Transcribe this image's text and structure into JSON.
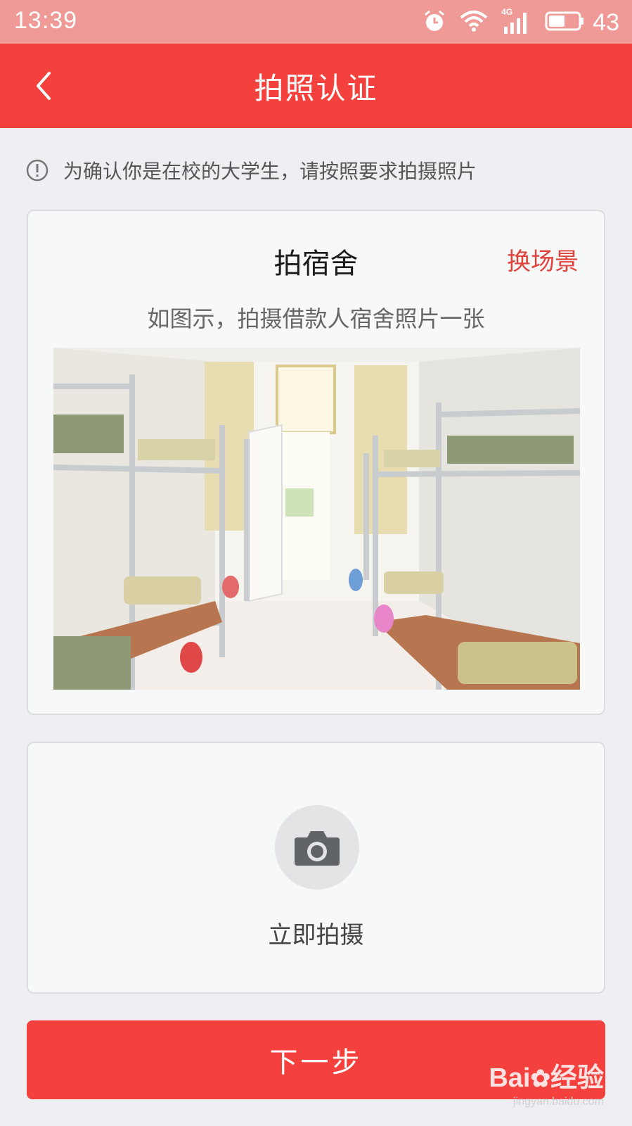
{
  "status_bar": {
    "time": "13:39",
    "network": "4G",
    "battery": "43",
    "icons": [
      "alarm-icon",
      "wifi-icon",
      "signal-icon",
      "battery-icon"
    ]
  },
  "header": {
    "back_icon": "chevron-left-icon",
    "title": "拍照认证"
  },
  "notice": {
    "icon": "info-circle-icon",
    "text": "为确认你是在校的大学生，请按照要求拍摄照片"
  },
  "example": {
    "title": "拍宿舍",
    "change_label": "换场景",
    "description": "如图示，拍摄借款人宿舍照片一张",
    "photo_subject": "dormitory-example-photo"
  },
  "capture": {
    "icon": "camera-icon",
    "label": "立即拍摄"
  },
  "next_button": {
    "label": "下一步"
  },
  "watermark": {
    "brand": "Bai",
    "brand_suffix": "经验",
    "url": "jingyan.baidu.com"
  },
  "colors": {
    "primary": "#f5413e",
    "status_bar": "#ef9a96",
    "background": "#efeff3",
    "accent_text": "#e0423c"
  }
}
